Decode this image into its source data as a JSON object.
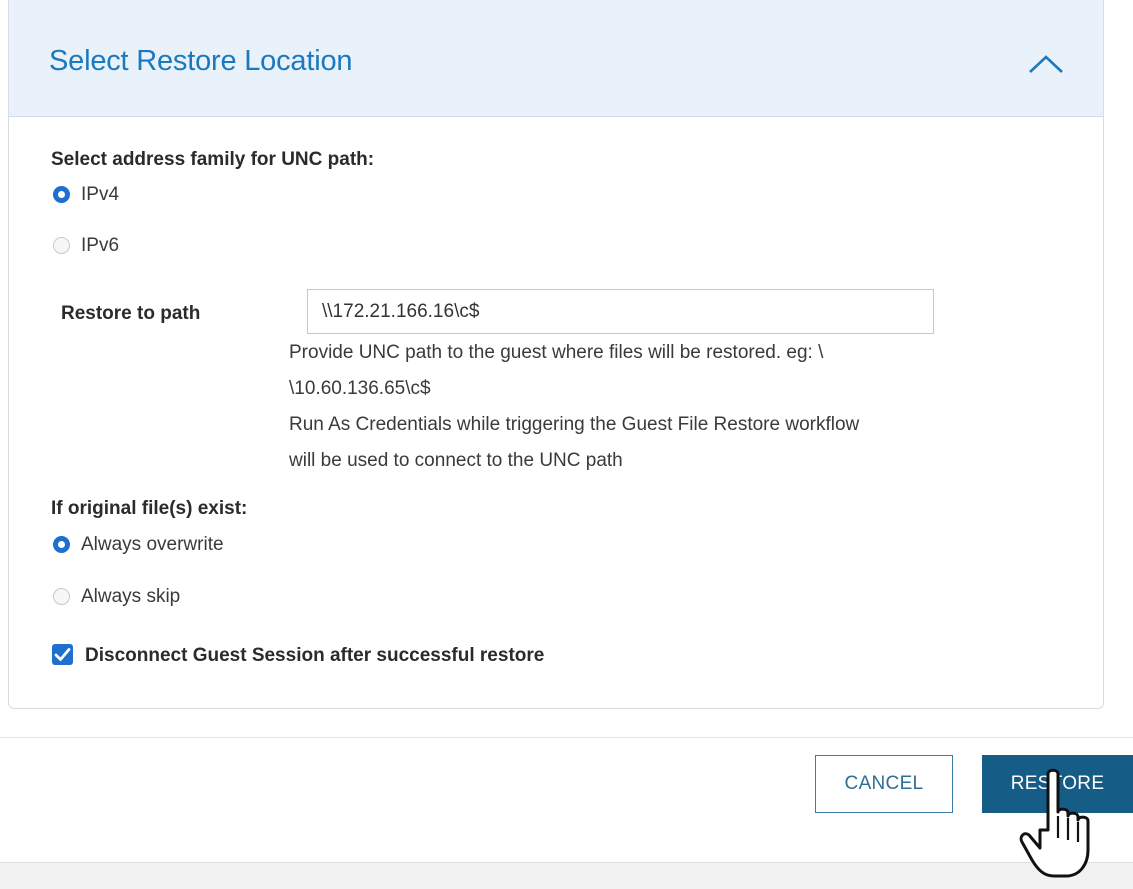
{
  "panel": {
    "title": "Select Restore Location",
    "collapse_icon": "chevron-up-icon"
  },
  "address_family": {
    "label": "Select address family for UNC path:",
    "options": [
      {
        "label": "IPv4",
        "selected": true
      },
      {
        "label": "IPv6",
        "selected": false
      }
    ]
  },
  "restore_path": {
    "label": "Restore to path",
    "value": "\\\\172.21.166.16\\c$",
    "help_lines": [
      "Provide UNC path to the guest where files will be restored. eg: \\",
      "\\10.60.136.65\\c$",
      "Run As Credentials while triggering the Guest File Restore workflow",
      "will be used to connect to the UNC path"
    ]
  },
  "original_files": {
    "label": "If original file(s) exist:",
    "options": [
      {
        "label": "Always overwrite",
        "selected": true
      },
      {
        "label": "Always skip",
        "selected": false
      }
    ]
  },
  "disconnect": {
    "label": "Disconnect Guest Session after successful restore",
    "checked": true
  },
  "footer": {
    "cancel_label": "CANCEL",
    "restore_label": "RESTORE"
  },
  "colors": {
    "accent": "#1f6fd1",
    "title": "#1c79bd",
    "header_bg": "#e9f1fa",
    "primary_button": "#155c87"
  }
}
